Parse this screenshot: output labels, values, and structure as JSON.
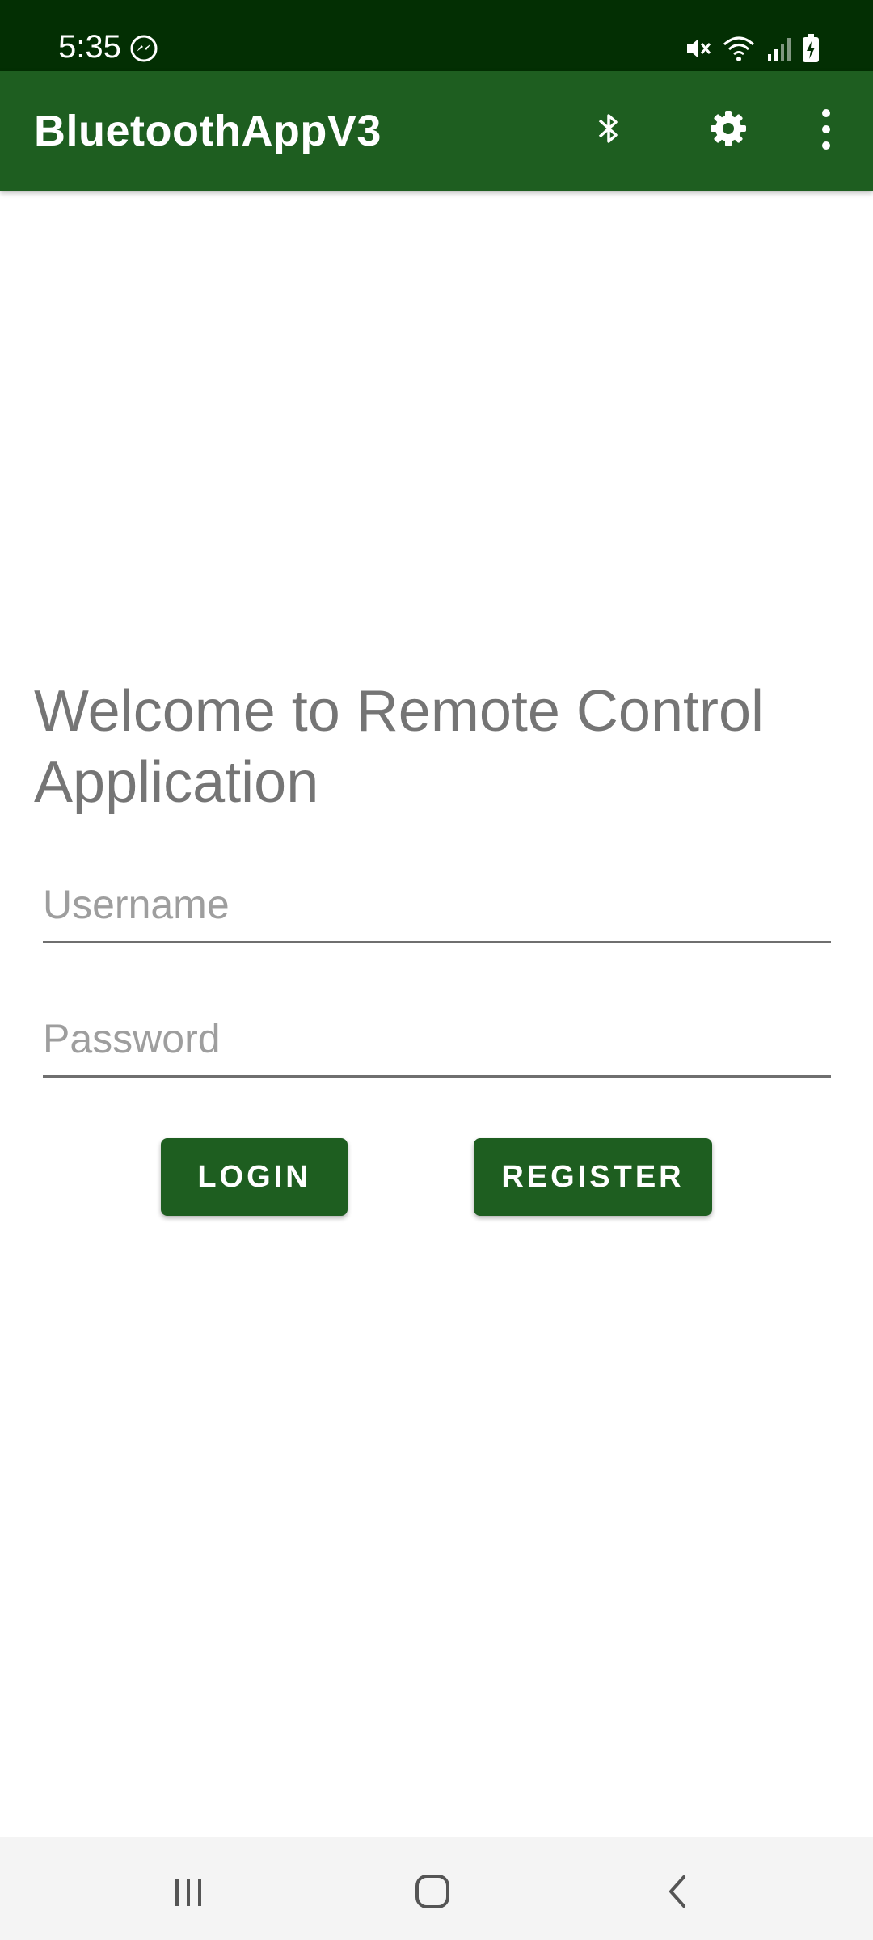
{
  "status_bar": {
    "time": "5:35",
    "icons": [
      "messenger-icon",
      "mute-icon",
      "wifi-icon",
      "signal-icon",
      "battery-charging-icon"
    ]
  },
  "app_bar": {
    "title": "BluetoothAppV3",
    "actions": [
      "bluetooth-icon",
      "gear-icon",
      "more-vert-icon"
    ]
  },
  "main": {
    "welcome_text": "Welcome to Remote Control Application",
    "username_placeholder": "Username",
    "password_placeholder": "Password",
    "login_label": "LOGIN",
    "register_label": "REGISTER"
  },
  "nav_bar": {
    "buttons": [
      "recents-icon",
      "home-icon",
      "back-icon"
    ]
  },
  "colors": {
    "status_bar": "#032f03",
    "app_bar": "#1e5e20",
    "button": "#1e5e20",
    "welcome_text": "#757575"
  }
}
